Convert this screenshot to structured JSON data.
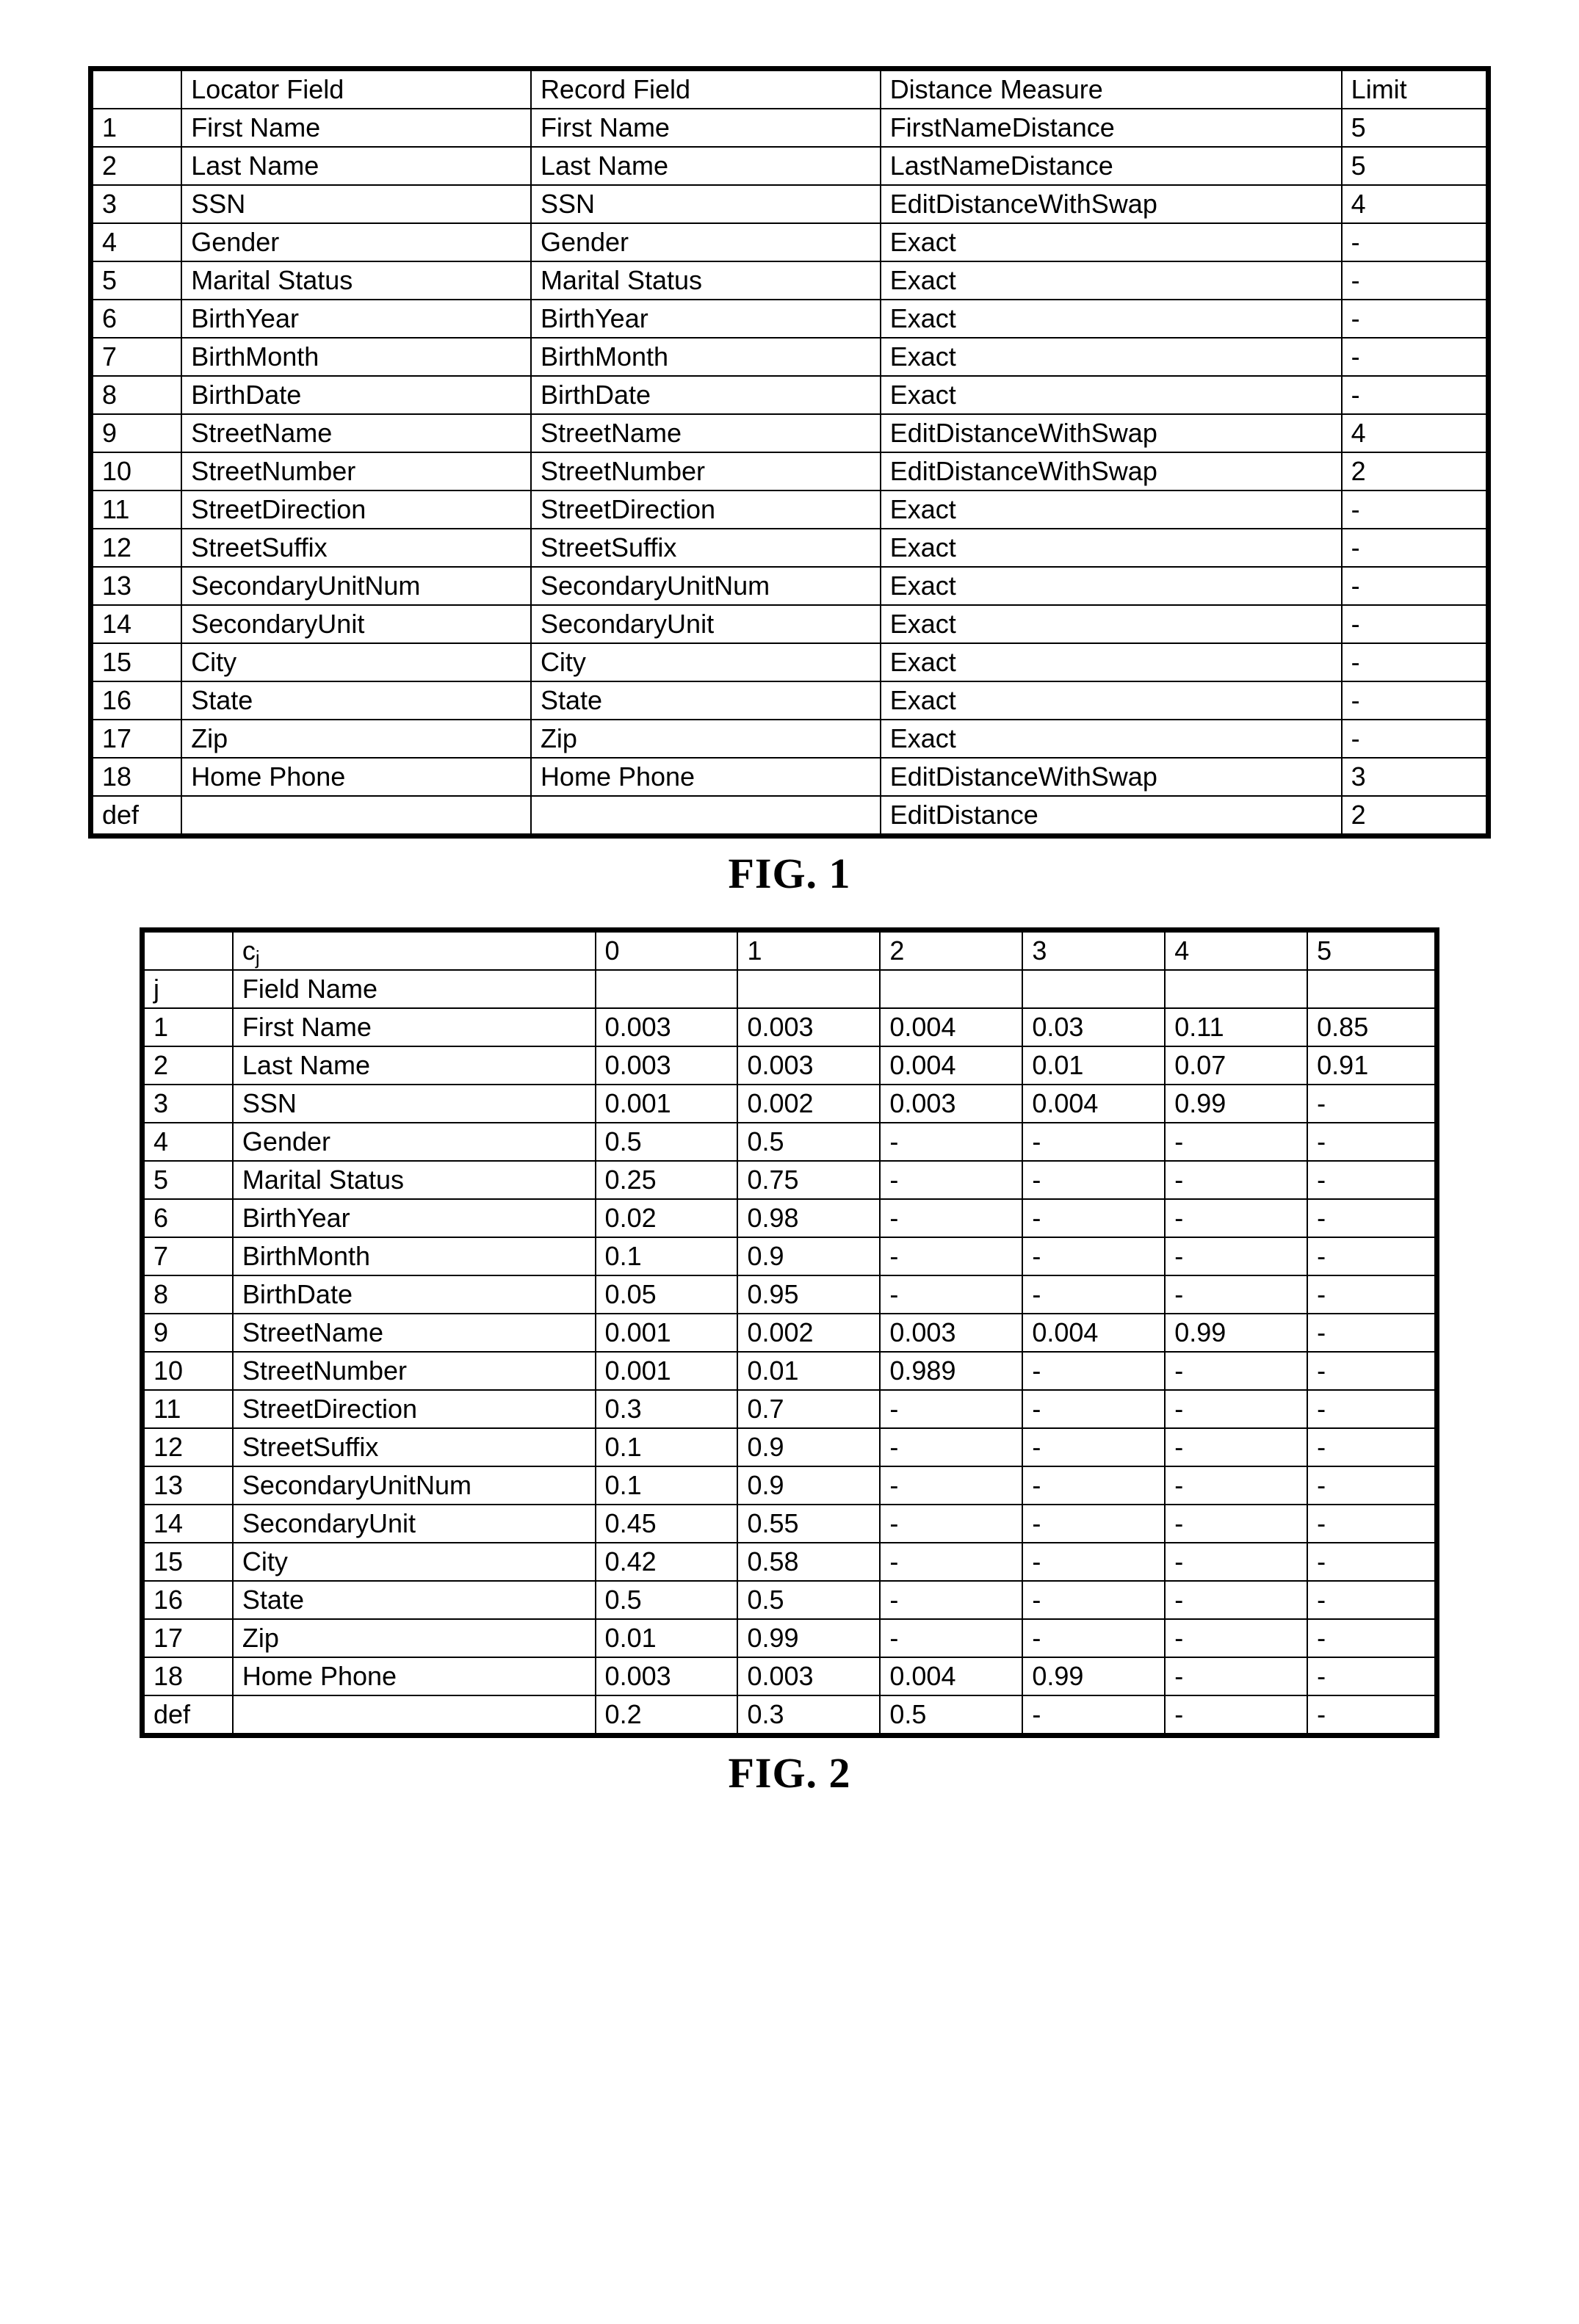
{
  "fig1": {
    "caption": "FIG. 1",
    "headers": [
      "",
      "Locator Field",
      "Record Field",
      "Distance Measure",
      "Limit"
    ],
    "rows": [
      [
        "1",
        "First Name",
        "First Name",
        "FirstNameDistance",
        "5"
      ],
      [
        "2",
        "Last Name",
        "Last Name",
        "LastNameDistance",
        "5"
      ],
      [
        "3",
        "SSN",
        "SSN",
        "EditDistanceWithSwap",
        "4"
      ],
      [
        "4",
        "Gender",
        "Gender",
        "Exact",
        "-"
      ],
      [
        "5",
        "Marital Status",
        "Marital Status",
        "Exact",
        "-"
      ],
      [
        "6",
        "BirthYear",
        "BirthYear",
        "Exact",
        "-"
      ],
      [
        "7",
        "BirthMonth",
        "BirthMonth",
        "Exact",
        "-"
      ],
      [
        "8",
        "BirthDate",
        "BirthDate",
        "Exact",
        "-"
      ],
      [
        "9",
        "StreetName",
        "StreetName",
        "EditDistanceWithSwap",
        "4"
      ],
      [
        "10",
        "StreetNumber",
        "StreetNumber",
        "EditDistanceWithSwap",
        "2"
      ],
      [
        "11",
        "StreetDirection",
        "StreetDirection",
        "Exact",
        "-"
      ],
      [
        "12",
        "StreetSuffix",
        "StreetSuffix",
        "Exact",
        "-"
      ],
      [
        "13",
        "SecondaryUnitNum",
        "SecondaryUnitNum",
        "Exact",
        "-"
      ],
      [
        "14",
        "SecondaryUnit",
        "SecondaryUnit",
        "Exact",
        "-"
      ],
      [
        "15",
        "City",
        "City",
        "Exact",
        "-"
      ],
      [
        "16",
        "State",
        "State",
        "Exact",
        "-"
      ],
      [
        "17",
        "Zip",
        "Zip",
        "Exact",
        "-"
      ],
      [
        "18",
        "Home Phone",
        "Home Phone",
        "EditDistanceWithSwap",
        "3"
      ],
      [
        "def",
        "",
        "",
        "EditDistance",
        "2"
      ]
    ]
  },
  "fig2": {
    "caption": "FIG. 2",
    "header_row1": [
      "",
      "c",
      "0",
      "1",
      "2",
      "3",
      "4",
      "5"
    ],
    "header_row1_sub": "j",
    "header_row2": [
      "j",
      "Field Name",
      "",
      "",
      "",
      "",
      "",
      ""
    ],
    "rows": [
      [
        "1",
        "First Name",
        "0.003",
        "0.003",
        "0.004",
        "0.03",
        "0.11",
        "0.85"
      ],
      [
        "2",
        "Last Name",
        "0.003",
        "0.003",
        "0.004",
        "0.01",
        "0.07",
        "0.91"
      ],
      [
        "3",
        "SSN",
        "0.001",
        "0.002",
        "0.003",
        "0.004",
        "0.99",
        "-"
      ],
      [
        "4",
        "Gender",
        "0.5",
        "0.5",
        "-",
        "-",
        "-",
        "-"
      ],
      [
        "5",
        "Marital Status",
        "0.25",
        "0.75",
        "-",
        "-",
        "-",
        "-"
      ],
      [
        "6",
        "BirthYear",
        "0.02",
        "0.98",
        "-",
        "-",
        "-",
        "-"
      ],
      [
        "7",
        "BirthMonth",
        "0.1",
        "0.9",
        "-",
        "-",
        "-",
        "-"
      ],
      [
        "8",
        "BirthDate",
        "0.05",
        "0.95",
        "-",
        "-",
        "-",
        "-"
      ],
      [
        "9",
        "StreetName",
        "0.001",
        "0.002",
        "0.003",
        "0.004",
        "0.99",
        "-"
      ],
      [
        "10",
        "StreetNumber",
        "0.001",
        "0.01",
        "0.989",
        "-",
        "-",
        "-"
      ],
      [
        "11",
        "StreetDirection",
        "0.3",
        "0.7",
        "-",
        "-",
        "-",
        "-"
      ],
      [
        "12",
        "StreetSuffix",
        "0.1",
        "0.9",
        "-",
        "-",
        "-",
        "-"
      ],
      [
        "13",
        "SecondaryUnitNum",
        "0.1",
        "0.9",
        "-",
        "-",
        "-",
        "-"
      ],
      [
        "14",
        "SecondaryUnit",
        "0.45",
        "0.55",
        "-",
        "-",
        "-",
        "-"
      ],
      [
        "15",
        "City",
        "0.42",
        "0.58",
        "-",
        "-",
        "-",
        "-"
      ],
      [
        "16",
        "State",
        "0.5",
        "0.5",
        "-",
        "-",
        "-",
        "-"
      ],
      [
        "17",
        "Zip",
        "0.01",
        "0.99",
        "-",
        "-",
        "-",
        "-"
      ],
      [
        "18",
        "Home Phone",
        "0.003",
        "0.003",
        "0.004",
        "0.99",
        "-",
        "-"
      ],
      [
        "def",
        "",
        "0.2",
        "0.3",
        "0.5",
        "-",
        "-",
        "-"
      ]
    ]
  }
}
